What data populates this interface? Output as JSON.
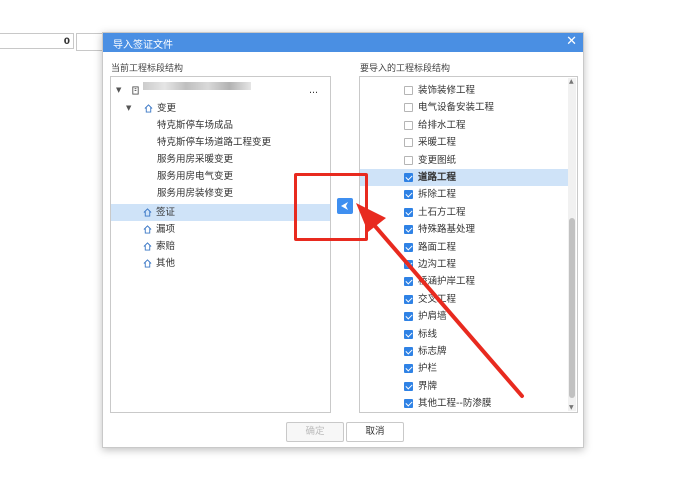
{
  "background": {
    "cell_value": "0"
  },
  "dialog": {
    "title": "导入签证文件",
    "close_icon": "close-icon",
    "left_label": "当前工程标段结构",
    "right_label": "要导入的工程标段结构",
    "confirm_label": "确定",
    "cancel_label": "取消",
    "accent_color": "#4a8fe3",
    "highlight_color": "#e82a1f"
  },
  "left_tree": {
    "root_suffix": "...",
    "change_label": "变更",
    "change_children": [
      "特克斯停车场成品",
      "特克斯停车场道路工程变更",
      "服务用房采暖变更",
      "服务用房电气变更",
      "服务用房装修变更"
    ],
    "visa_label": "签证",
    "omission_label": "漏项",
    "claim_label": "索赔",
    "other_label": "其他"
  },
  "right_tree": {
    "items": [
      {
        "label": "装饰装修工程",
        "checked": false
      },
      {
        "label": "电气设备安装工程",
        "checked": false
      },
      {
        "label": "给排水工程",
        "checked": false
      },
      {
        "label": "采暖工程",
        "checked": false
      },
      {
        "label": "变更图纸",
        "checked": false
      },
      {
        "label": "道路工程",
        "checked": true
      },
      {
        "label": "拆除工程",
        "checked": true
      },
      {
        "label": "土石方工程",
        "checked": true
      },
      {
        "label": "特殊路基处理",
        "checked": true
      },
      {
        "label": "路面工程",
        "checked": true
      },
      {
        "label": "边沟工程",
        "checked": true
      },
      {
        "label": "桥涵护岸工程",
        "checked": true
      },
      {
        "label": "交叉工程",
        "checked": true
      },
      {
        "label": "护肩墙",
        "checked": true
      },
      {
        "label": "标线",
        "checked": true
      },
      {
        "label": "标志牌",
        "checked": true
      },
      {
        "label": "护栏",
        "checked": true
      },
      {
        "label": "界牌",
        "checked": true
      },
      {
        "label": "其他工程--防渗膜",
        "checked": true
      }
    ]
  }
}
